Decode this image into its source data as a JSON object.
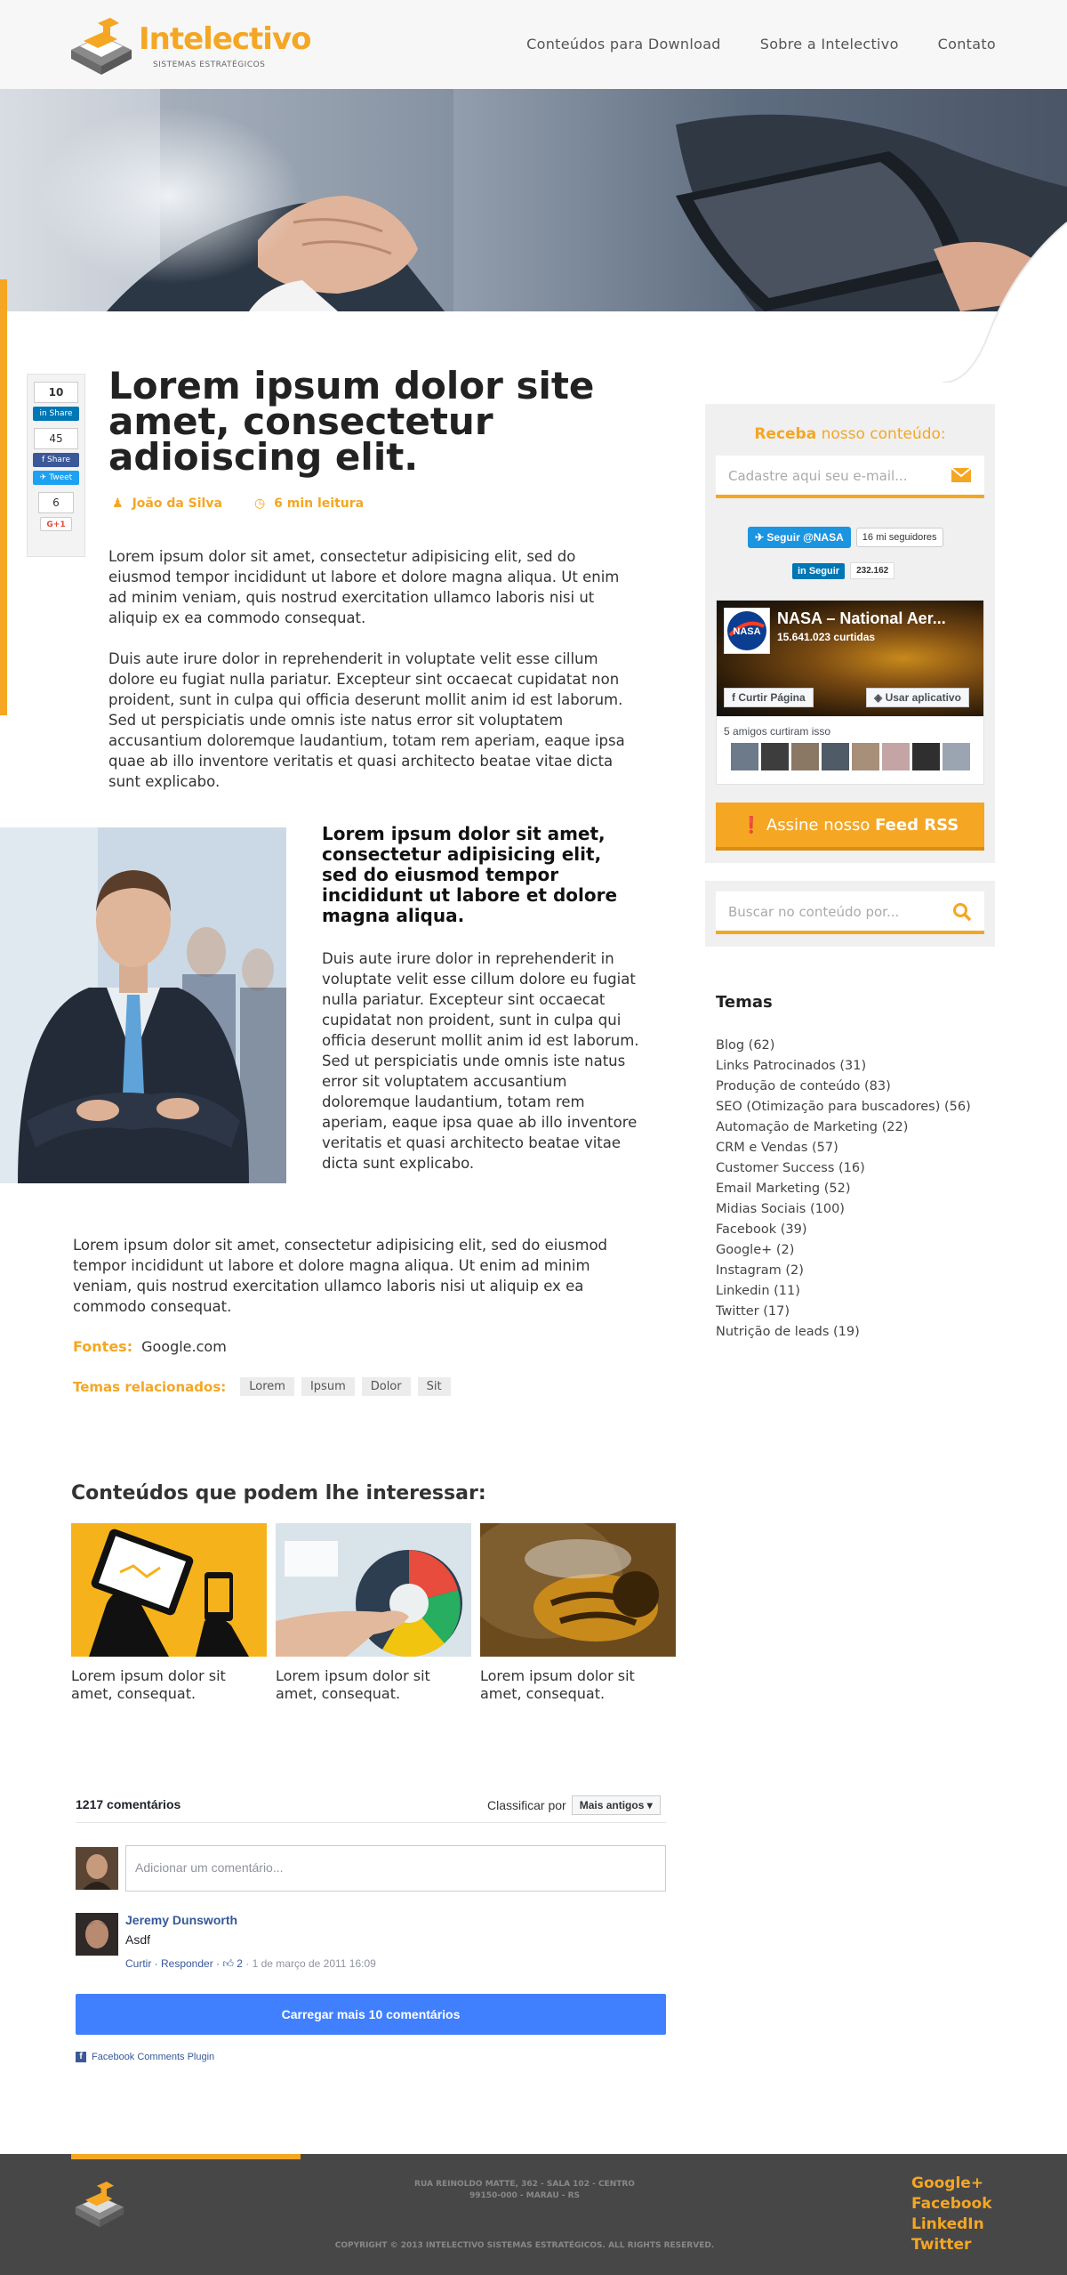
{
  "header": {
    "logo_name": "Intelectivo",
    "logo_sub": "SISTEMAS ESTRATÉGICOS",
    "nav": [
      "Conteúdos para Download",
      "Sobre a Intelectivo",
      "Contato"
    ]
  },
  "share": {
    "linkedin_count": "10",
    "linkedin_label": "Share",
    "facebook_count": "45",
    "facebook_label": "Share",
    "twitter_label": "Tweet",
    "gplus_count": "6",
    "gplus_label": "G+1"
  },
  "article": {
    "title_bold": "Lorem ipsum",
    "title_rest": " dolor site amet, consectetur adioiscing elit.",
    "author": "João da Silva",
    "read_time": "6 min leitura",
    "p1": "Lorem ipsum dolor sit amet, consectetur adipisicing elit, sed do eiusmod tempor incididunt ut labore et dolore magna aliqua. Ut enim ad minim veniam, quis nostrud exercitation ullamco laboris nisi ut aliquip ex ea commodo consequat.",
    "p2": "Duis aute irure dolor in reprehenderit in voluptate velit esse cillum dolore eu fugiat nulla pariatur. Excepteur sint occaecat cupidatat non proident, sunt in culpa qui officia deserunt mollit anim id est laborum. Sed ut perspiciatis unde omnis iste natus error sit voluptatem accusantium doloremque laudantium, totam rem aperiam, eaque ipsa quae ab illo inventore veritatis et quasi architecto beatae vitae dicta sunt explicabo.",
    "lead": "Lorem ipsum dolor sit amet, consectetur adipisicing elit, sed do eiusmod tempor incididunt ut labore et dolore magna aliqua.",
    "p3": "Duis aute irure dolor in reprehenderit in voluptate velit esse cillum dolore eu fugiat nulla pariatur. Excepteur sint occaecat cupidatat non proident, sunt in culpa qui officia deserunt mollit anim id est laborum. Sed ut perspiciatis unde omnis iste natus error sit voluptatem accusantium doloremque laudantium, totam rem aperiam, eaque ipsa quae ab illo inventore veritatis et quasi architecto beatae vitae dicta sunt explicabo.",
    "p4": "Lorem ipsum dolor sit amet, consectetur adipisicing elit, sed do eiusmod tempor incididunt ut labore et dolore magna aliqua. Ut enim ad minim veniam, quis nostrud exercitation ullamco laboris nisi ut aliquip ex ea commodo consequat.",
    "fontes_label": "Fontes:",
    "fontes_value": "Google.com",
    "temas_label": "Temas relacionados:",
    "tags": [
      "Lorem",
      "Ipsum",
      "Dolor",
      "Sit"
    ]
  },
  "related": {
    "title": "Conteúdos que podem lhe interessar:",
    "items": [
      {
        "caption": "Lorem ipsum dolor sit amet, consequat."
      },
      {
        "caption": "Lorem ipsum dolor sit amet, consequat."
      },
      {
        "caption": "Lorem ipsum dolor sit amet, consequat."
      }
    ]
  },
  "comments": {
    "count": "1217 comentários",
    "sort_label": "Classificar por",
    "sort_value": "Mais antigos",
    "placeholder": "Adicionar um comentário...",
    "author": "Jeremy Dunsworth",
    "text": "Asdf",
    "actions": "Curtir · Responder · ",
    "likes": "2",
    "date": " · 1 de março de 2011 16:09",
    "load_more": "Carregar mais 10 comentários",
    "plugin": "Facebook Comments Plugin"
  },
  "sidebar": {
    "receba": "Receba",
    "receba_rest": " nosso conteúdo:",
    "email_placeholder": "Cadastre aqui seu e-mail...",
    "twitter_btn": "Seguir @NASA",
    "twitter_count": "16 mi seguidores",
    "linkedin_btn": "Seguir",
    "linkedin_count": "232.162",
    "fb_name": "NASA – National Aer...",
    "fb_likes": "15.641.023 curtidas",
    "fb_curtir": "Curtir Página",
    "fb_app": "Usar aplicativo",
    "fb_friends": "5 amigos curtiram isso",
    "rss_pre": "Assine nosso ",
    "rss_bold": "Feed RSS",
    "search_placeholder": "Buscar no conteúdo por...",
    "temas_title": "Temas",
    "temas": [
      "Blog (62)",
      "Links Patrocinados (31)",
      "Produção de conteúdo (83)",
      "SEO (Otimização para buscadores) (56)",
      "Automação de Marketing (22)",
      "CRM e Vendas (57)",
      "Customer Success (16)",
      "Email Marketing (52)",
      "Midias Sociais (100)",
      "Facebook (39)",
      "Google+ (2)",
      "Instagram (2)",
      "Linkedin (11)",
      "Twitter (17)",
      "Nutrição de leads (19)"
    ]
  },
  "footer": {
    "address1": "RUA REINOLDO MATTE, 362 - SALA 102 - CENTRO",
    "address2": "99150-000 - MARAU - RS",
    "copyright": "COPYRIGHT © 2013 INTELECTIVO SISTEMAS ESTRATÉGICOS. ALL RIGHTS RESERVED.",
    "social": [
      "Google+",
      "Facebook",
      "LinkedIn",
      "Twitter"
    ]
  },
  "colors": {
    "accent": "#f5a623",
    "footer_bg": "#474747",
    "fb_blue": "#4080ff"
  }
}
